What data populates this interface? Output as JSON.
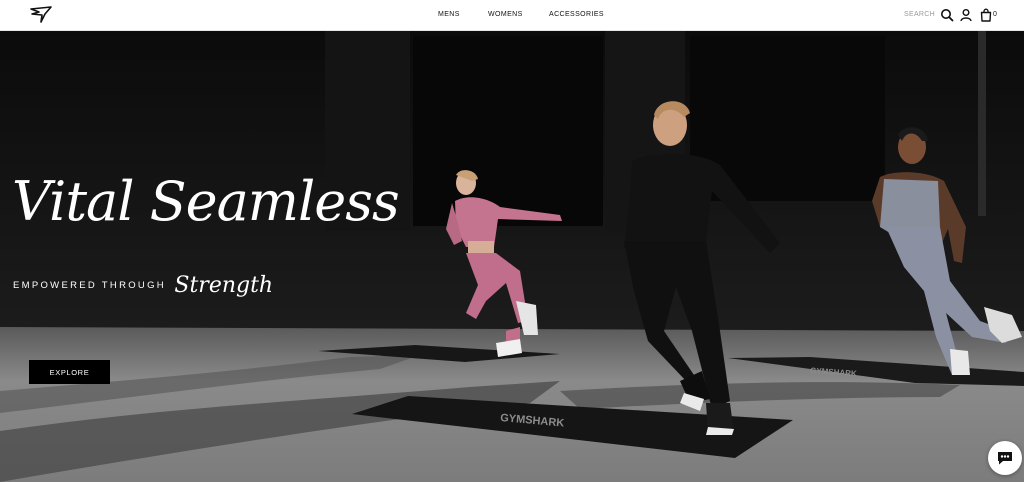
{
  "header": {
    "brand": "Gymshark",
    "nav": [
      {
        "label": "MENS"
      },
      {
        "label": "WOMENS"
      },
      {
        "label": "ACCESSORIES"
      }
    ],
    "search_label": "SEARCH",
    "bag_count": "0"
  },
  "hero": {
    "headline": "Vital Seamless",
    "subline_caps": "EMPOWERED THROUGH",
    "subline_script": "Strength",
    "cta_label": "EXPLORE",
    "mat_text_front": "GYMSHARK",
    "mat_text_back": "GYMSHARK"
  },
  "icons": [
    "gymshark-logo",
    "search-icon",
    "account-icon",
    "bag-icon",
    "chat-icon"
  ],
  "colors": {
    "header_bg": "#ffffff",
    "hero_top": "#0a0a0a",
    "floor": "#858585",
    "cta_bg": "#000000",
    "pink_set": "#c4748f",
    "black_set": "#121212",
    "grey_set": "#8a8f9e"
  }
}
